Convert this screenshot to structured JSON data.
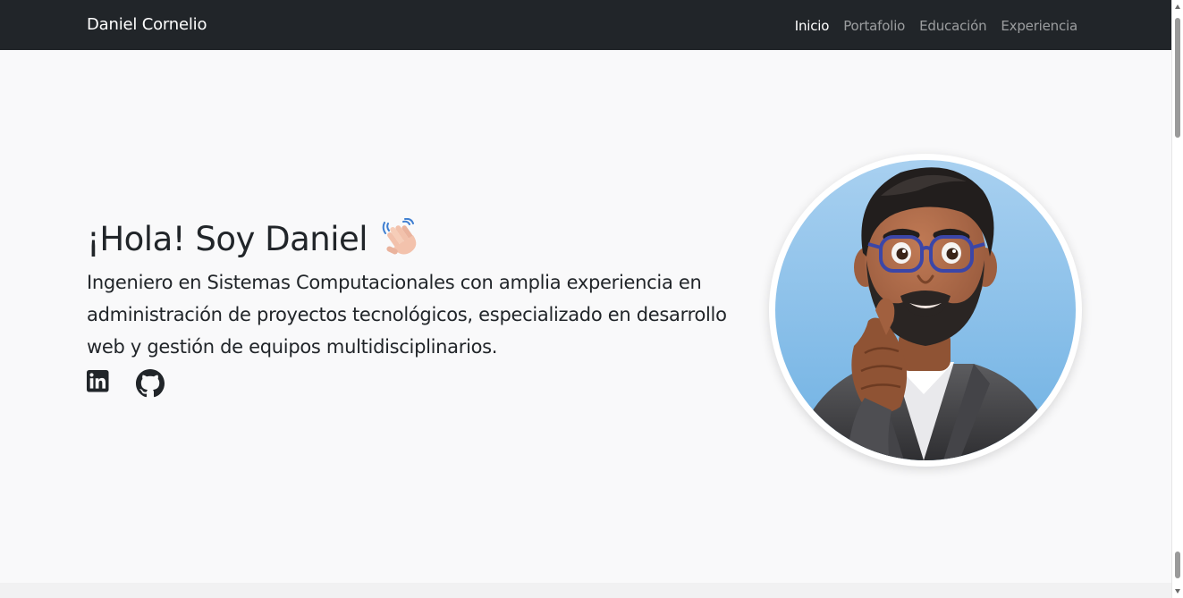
{
  "navbar": {
    "brand": "Daniel Cornelio",
    "links": [
      {
        "label": "Inicio",
        "active": true
      },
      {
        "label": "Portafolio",
        "active": false
      },
      {
        "label": "Educación",
        "active": false
      },
      {
        "label": "Experiencia",
        "active": false
      }
    ]
  },
  "hero": {
    "title": "¡Hola! Soy Daniel",
    "title_icon": "waving-hand-icon",
    "description": "Ingeniero en Sistemas Computacionales con amplia experiencia en administración de proyectos tecnológicos, especializado en desarrollo web y gestión de equipos multidisciplinarios.",
    "socials": [
      {
        "icon": "linkedin-icon"
      },
      {
        "icon": "github-icon"
      }
    ],
    "avatar_icon": "memoji-avatar"
  },
  "colors": {
    "navbar_bg": "#212529",
    "page_bg": "#f9f9fa",
    "avatar_bg": "#8cc1e9"
  }
}
